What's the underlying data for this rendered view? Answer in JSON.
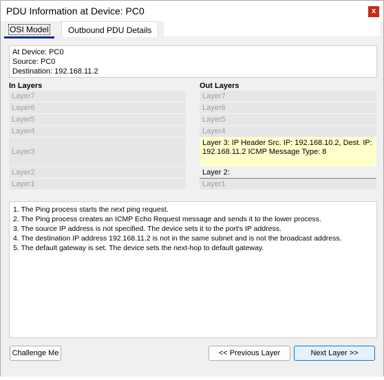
{
  "window": {
    "title": "PDU Information at Device: PC0",
    "close_label": "x"
  },
  "tabs": [
    {
      "label": "OSI Model"
    },
    {
      "label": "Outbound PDU Details"
    }
  ],
  "info": {
    "device": "At Device: PC0",
    "source": "Source: PC0",
    "destination": "Destination: 192.168.11.2"
  },
  "in_layers": {
    "heading": "In Layers",
    "items": [
      "Layer7",
      "Layer6",
      "Layer5",
      "Layer4",
      "Layer3",
      "Layer2",
      "Layer1"
    ]
  },
  "out_layers": {
    "heading": "Out Layers",
    "items": [
      "Layer7",
      "Layer6",
      "Layer5",
      "Layer4",
      "Layer 3: IP Header Src. IP: 192.168.10.2, Dest. IP: 192.168.11.2 ICMP Message Type: 8",
      "Layer 2:",
      "Layer1"
    ]
  },
  "messages": [
    "1. The Ping process starts the next ping request.",
    "2. The Ping process creates an ICMP Echo Request message and sends it to the lower process.",
    "3. The source IP address is not specified. The device sets it to the port's IP address.",
    "4. The destination IP address 192.168.11.2 is not in the same subnet and is not the broadcast address.",
    "5. The default gateway is set. The device sets the next-hop to default gateway."
  ],
  "buttons": {
    "challenge": "Challenge Me",
    "previous": "<< Previous Layer",
    "next": "Next Layer >>"
  },
  "colors": {
    "highlight": "#ffffcc",
    "accent": "#0078d7",
    "close": "#c42b1c"
  }
}
